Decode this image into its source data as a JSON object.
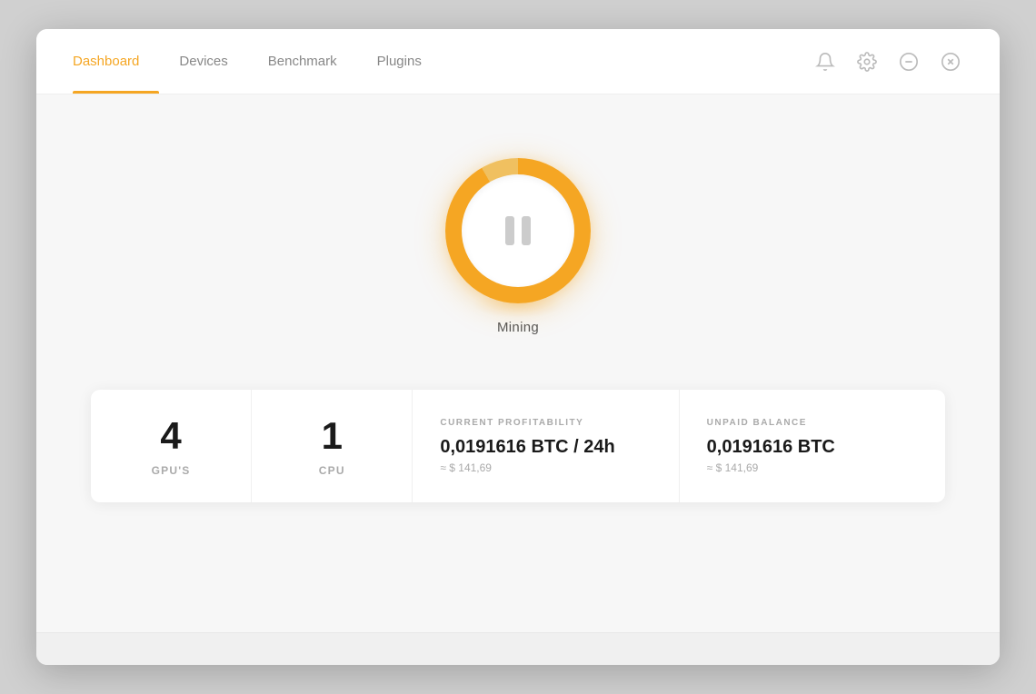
{
  "nav": {
    "tabs": [
      {
        "id": "dashboard",
        "label": "Dashboard",
        "active": true
      },
      {
        "id": "devices",
        "label": "Devices",
        "active": false
      },
      {
        "id": "benchmark",
        "label": "Benchmark",
        "active": false
      },
      {
        "id": "plugins",
        "label": "Plugins",
        "active": false
      }
    ]
  },
  "header_actions": {
    "bell_icon": "bell",
    "settings_icon": "settings",
    "minimize_icon": "minus-circle",
    "close_icon": "x-circle"
  },
  "mining": {
    "button_label": "Mining",
    "state": "paused"
  },
  "stats": [
    {
      "id": "gpus",
      "value": "4",
      "label": "GPU'S"
    },
    {
      "id": "cpu",
      "value": "1",
      "label": "CPU"
    }
  ],
  "profitability": {
    "title": "CURRENT PROFITABILITY",
    "main_value": "0,0191616",
    "main_unit": " BTC / 24h",
    "sub_value": "≈ $ 141,69"
  },
  "balance": {
    "title": "UNPAID BALANCE",
    "main_value": "0,0191616",
    "main_unit": " BTC",
    "sub_value": "≈ $ 141,69"
  },
  "colors": {
    "accent": "#f5a623",
    "text_primary": "#1a1a1a",
    "text_muted": "#aaa",
    "active_tab": "#f5a623"
  }
}
